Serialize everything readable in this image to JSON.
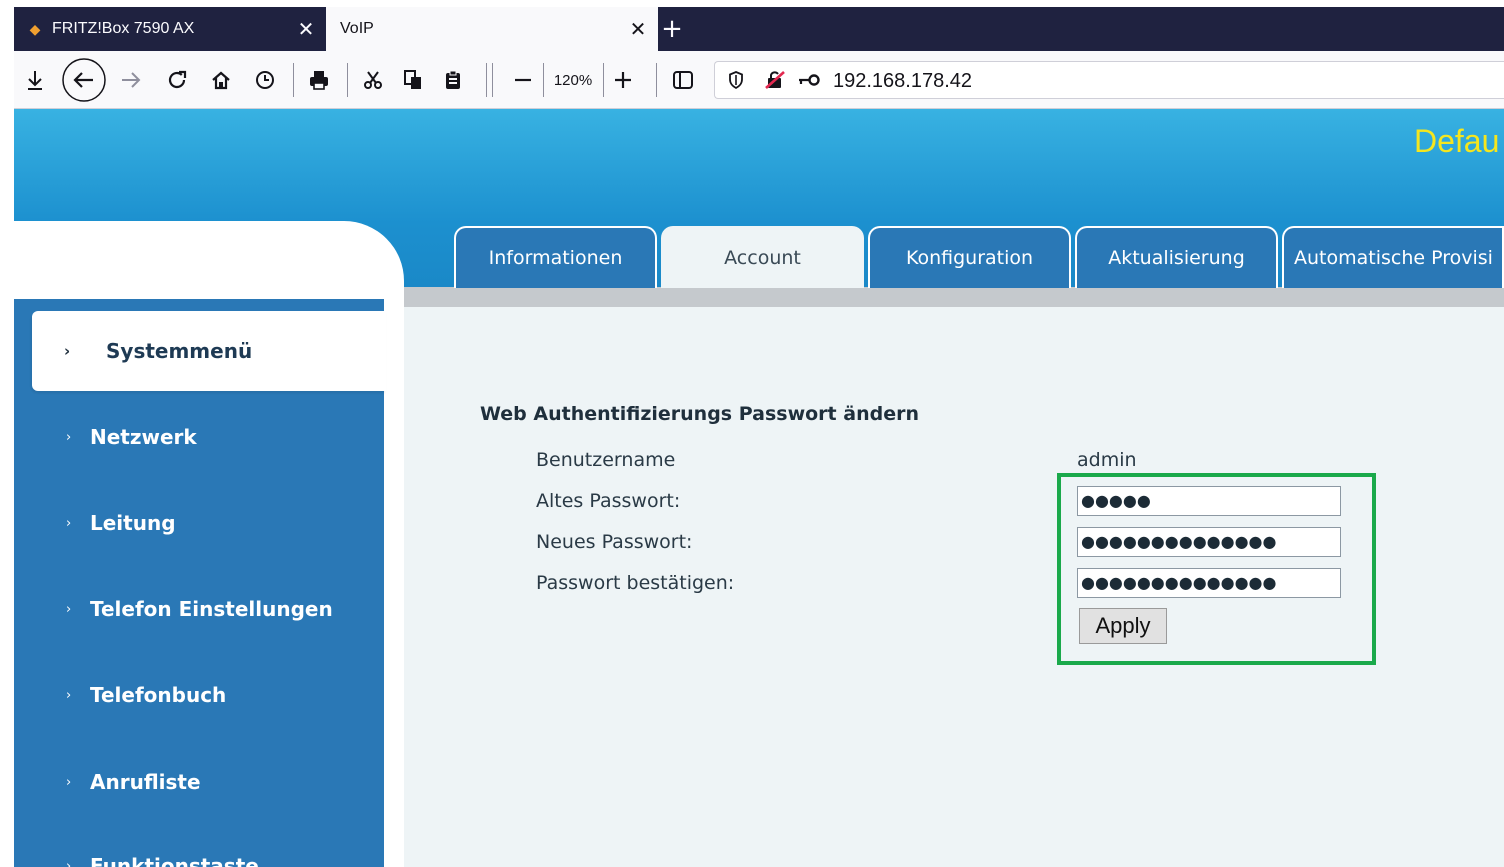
{
  "browser": {
    "tabs": [
      {
        "title": "FRITZ!Box 7590 AX"
      },
      {
        "title": "VoIP"
      }
    ],
    "zoom": "120%",
    "url": "192.168.178.42"
  },
  "header": {
    "brand_text": "Defau"
  },
  "nav_tabs": [
    {
      "label": "Informationen"
    },
    {
      "label": "Account"
    },
    {
      "label": "Konfiguration"
    },
    {
      "label": "Aktualisierung"
    },
    {
      "label": "Automatische Provisi"
    }
  ],
  "sidebar": {
    "active": "Systemmenü",
    "items": [
      {
        "label": "Netzwerk"
      },
      {
        "label": "Leitung"
      },
      {
        "label": "Telefon Einstellungen"
      },
      {
        "label": "Telefonbuch"
      },
      {
        "label": "Anrufliste"
      },
      {
        "label": "Funktionstaste"
      }
    ]
  },
  "form": {
    "title": "Web Authentifizierungs Passwort ändern",
    "username_label": "Benutzername",
    "username_value": "admin",
    "old_password_label": "Altes Passwort:",
    "old_password_value": "●●●●●",
    "new_password_label": "Neues Passwort:",
    "new_password_value": "●●●●●●●●●●●●●●",
    "confirm_password_label": "Passwort bestätigen:",
    "confirm_password_value": "●●●●●●●●●●●●●●",
    "apply_label": "Apply"
  },
  "colors": {
    "highlight_box": "#1aa94b",
    "sidebar_bg": "#2a78b6",
    "header_gradient_top": "#38b2e2",
    "brand_yellow": "#f5e61e"
  }
}
